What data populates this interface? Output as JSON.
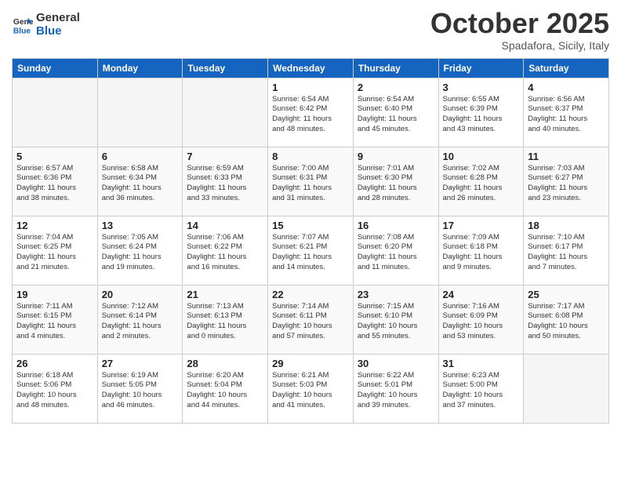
{
  "header": {
    "logo_line1": "General",
    "logo_line2": "Blue",
    "month": "October 2025",
    "location": "Spadafora, Sicily, Italy"
  },
  "days_of_week": [
    "Sunday",
    "Monday",
    "Tuesday",
    "Wednesday",
    "Thursday",
    "Friday",
    "Saturday"
  ],
  "weeks": [
    [
      {
        "day": "",
        "info": ""
      },
      {
        "day": "",
        "info": ""
      },
      {
        "day": "",
        "info": ""
      },
      {
        "day": "1",
        "info": "Sunrise: 6:54 AM\nSunset: 6:42 PM\nDaylight: 11 hours\nand 48 minutes."
      },
      {
        "day": "2",
        "info": "Sunrise: 6:54 AM\nSunset: 6:40 PM\nDaylight: 11 hours\nand 45 minutes."
      },
      {
        "day": "3",
        "info": "Sunrise: 6:55 AM\nSunset: 6:39 PM\nDaylight: 11 hours\nand 43 minutes."
      },
      {
        "day": "4",
        "info": "Sunrise: 6:56 AM\nSunset: 6:37 PM\nDaylight: 11 hours\nand 40 minutes."
      }
    ],
    [
      {
        "day": "5",
        "info": "Sunrise: 6:57 AM\nSunset: 6:36 PM\nDaylight: 11 hours\nand 38 minutes."
      },
      {
        "day": "6",
        "info": "Sunrise: 6:58 AM\nSunset: 6:34 PM\nDaylight: 11 hours\nand 36 minutes."
      },
      {
        "day": "7",
        "info": "Sunrise: 6:59 AM\nSunset: 6:33 PM\nDaylight: 11 hours\nand 33 minutes."
      },
      {
        "day": "8",
        "info": "Sunrise: 7:00 AM\nSunset: 6:31 PM\nDaylight: 11 hours\nand 31 minutes."
      },
      {
        "day": "9",
        "info": "Sunrise: 7:01 AM\nSunset: 6:30 PM\nDaylight: 11 hours\nand 28 minutes."
      },
      {
        "day": "10",
        "info": "Sunrise: 7:02 AM\nSunset: 6:28 PM\nDaylight: 11 hours\nand 26 minutes."
      },
      {
        "day": "11",
        "info": "Sunrise: 7:03 AM\nSunset: 6:27 PM\nDaylight: 11 hours\nand 23 minutes."
      }
    ],
    [
      {
        "day": "12",
        "info": "Sunrise: 7:04 AM\nSunset: 6:25 PM\nDaylight: 11 hours\nand 21 minutes."
      },
      {
        "day": "13",
        "info": "Sunrise: 7:05 AM\nSunset: 6:24 PM\nDaylight: 11 hours\nand 19 minutes."
      },
      {
        "day": "14",
        "info": "Sunrise: 7:06 AM\nSunset: 6:22 PM\nDaylight: 11 hours\nand 16 minutes."
      },
      {
        "day": "15",
        "info": "Sunrise: 7:07 AM\nSunset: 6:21 PM\nDaylight: 11 hours\nand 14 minutes."
      },
      {
        "day": "16",
        "info": "Sunrise: 7:08 AM\nSunset: 6:20 PM\nDaylight: 11 hours\nand 11 minutes."
      },
      {
        "day": "17",
        "info": "Sunrise: 7:09 AM\nSunset: 6:18 PM\nDaylight: 11 hours\nand 9 minutes."
      },
      {
        "day": "18",
        "info": "Sunrise: 7:10 AM\nSunset: 6:17 PM\nDaylight: 11 hours\nand 7 minutes."
      }
    ],
    [
      {
        "day": "19",
        "info": "Sunrise: 7:11 AM\nSunset: 6:15 PM\nDaylight: 11 hours\nand 4 minutes."
      },
      {
        "day": "20",
        "info": "Sunrise: 7:12 AM\nSunset: 6:14 PM\nDaylight: 11 hours\nand 2 minutes."
      },
      {
        "day": "21",
        "info": "Sunrise: 7:13 AM\nSunset: 6:13 PM\nDaylight: 11 hours\nand 0 minutes."
      },
      {
        "day": "22",
        "info": "Sunrise: 7:14 AM\nSunset: 6:11 PM\nDaylight: 10 hours\nand 57 minutes."
      },
      {
        "day": "23",
        "info": "Sunrise: 7:15 AM\nSunset: 6:10 PM\nDaylight: 10 hours\nand 55 minutes."
      },
      {
        "day": "24",
        "info": "Sunrise: 7:16 AM\nSunset: 6:09 PM\nDaylight: 10 hours\nand 53 minutes."
      },
      {
        "day": "25",
        "info": "Sunrise: 7:17 AM\nSunset: 6:08 PM\nDaylight: 10 hours\nand 50 minutes."
      }
    ],
    [
      {
        "day": "26",
        "info": "Sunrise: 6:18 AM\nSunset: 5:06 PM\nDaylight: 10 hours\nand 48 minutes."
      },
      {
        "day": "27",
        "info": "Sunrise: 6:19 AM\nSunset: 5:05 PM\nDaylight: 10 hours\nand 46 minutes."
      },
      {
        "day": "28",
        "info": "Sunrise: 6:20 AM\nSunset: 5:04 PM\nDaylight: 10 hours\nand 44 minutes."
      },
      {
        "day": "29",
        "info": "Sunrise: 6:21 AM\nSunset: 5:03 PM\nDaylight: 10 hours\nand 41 minutes."
      },
      {
        "day": "30",
        "info": "Sunrise: 6:22 AM\nSunset: 5:01 PM\nDaylight: 10 hours\nand 39 minutes."
      },
      {
        "day": "31",
        "info": "Sunrise: 6:23 AM\nSunset: 5:00 PM\nDaylight: 10 hours\nand 37 minutes."
      },
      {
        "day": "",
        "info": ""
      }
    ]
  ]
}
